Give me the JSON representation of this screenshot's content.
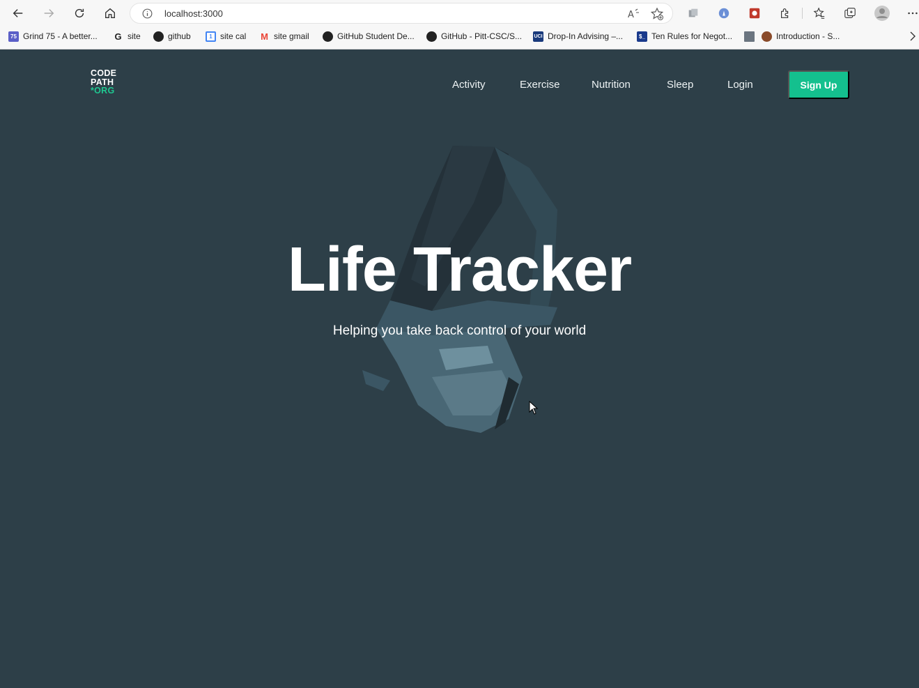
{
  "browser": {
    "url": "localhost:3000",
    "bookmarks": [
      {
        "label": "Grind 75 - A better...",
        "icon": "grind75-icon",
        "badge": "75"
      },
      {
        "label": "site",
        "icon": "site-c-icon"
      },
      {
        "label": "github",
        "icon": "github-icon"
      },
      {
        "label": "site cal",
        "icon": "calendar-icon",
        "badge": "1"
      },
      {
        "label": "site gmail",
        "icon": "gmail-icon"
      },
      {
        "label": "GitHub Student De...",
        "icon": "github-icon"
      },
      {
        "label": "GitHub - Pitt-CSC/S...",
        "icon": "github-icon"
      },
      {
        "label": "Drop-In Advising –...",
        "icon": "uci-icon",
        "badge": "UCI"
      },
      {
        "label": "Ten Rules for Negot...",
        "icon": "dollar-terminal-icon",
        "badge": "$_"
      },
      {
        "label": "",
        "icon": "monitor-icon"
      },
      {
        "label": "Introduction - S...",
        "icon": "rust-icon"
      }
    ]
  },
  "app": {
    "logo": {
      "line1": "CODE",
      "line2": "PATH",
      "line3": "*ORG"
    },
    "nav": [
      {
        "label": "Activity"
      },
      {
        "label": "Exercise"
      },
      {
        "label": "Nutrition"
      },
      {
        "label": "Sleep"
      },
      {
        "label": "Login"
      }
    ],
    "signup_label": "Sign Up",
    "hero": {
      "title": "Life Tracker",
      "subtitle": "Helping you take back control of your world"
    }
  },
  "colors": {
    "background": "#2d3f48",
    "accent": "#14c08e",
    "logo_accent": "#1fc891"
  }
}
